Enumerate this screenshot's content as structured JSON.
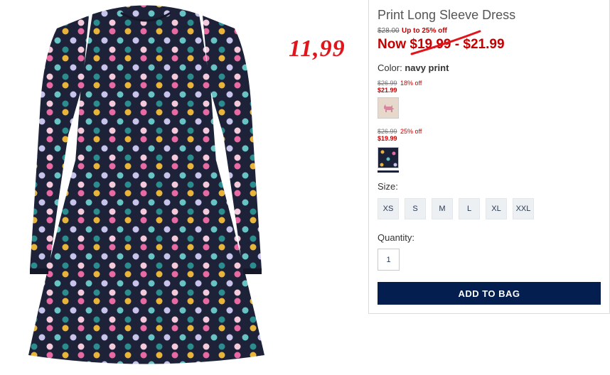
{
  "product": {
    "title": "Print Long Sleeve Dress",
    "original_price": "$28.00",
    "discount_text": "Up to 25% off",
    "now_label": "Now",
    "now_low": "$19.99",
    "now_sep": " - ",
    "now_high": "$21.99"
  },
  "annotation": {
    "handwritten_price": "11,99"
  },
  "color": {
    "label": "Color:",
    "value": "navy print"
  },
  "swatches": [
    {
      "old": "$26.99",
      "off": "18% off",
      "new": "$21.99",
      "color": "#e6d8cb",
      "icon": "scottie-dog-icon"
    },
    {
      "old": "$26.99",
      "off": "25% off",
      "new": "$19.99",
      "color": "#1b2138",
      "icon": "polka-dot-icon"
    }
  ],
  "size": {
    "label": "Size:",
    "options": [
      "XS",
      "S",
      "M",
      "L",
      "XL",
      "XXL"
    ]
  },
  "quantity": {
    "label": "Quantity:",
    "value": "1"
  },
  "add_to_bag": "ADD TO BAG",
  "colors": {
    "accent_red": "#c40000",
    "navy": "#041e50",
    "annotation_red": "#e0161c"
  }
}
